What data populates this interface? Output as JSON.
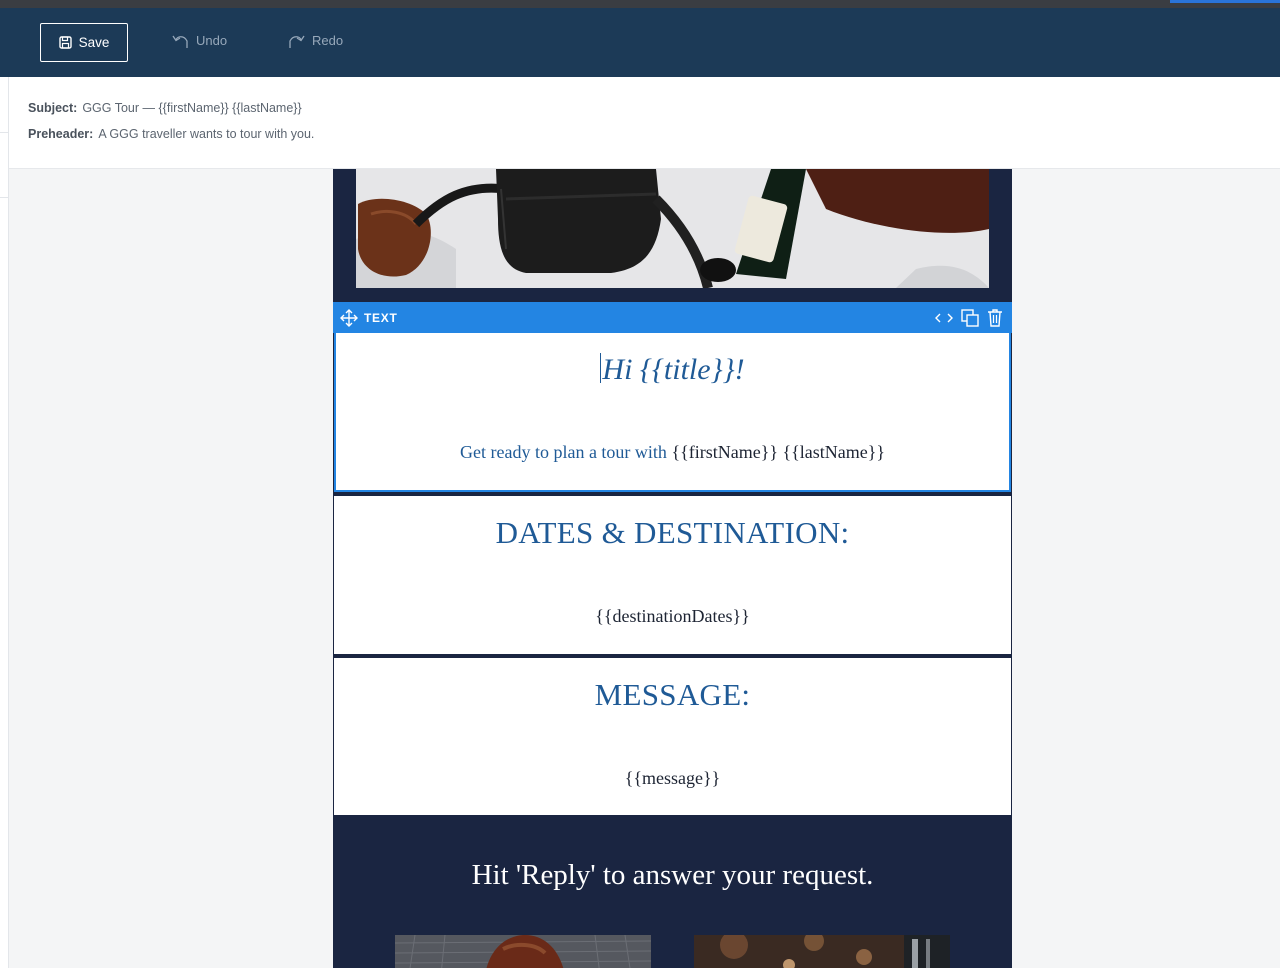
{
  "toolbar": {
    "save_label": "Save",
    "undo_label": "Undo",
    "redo_label": "Redo",
    "background": "#1c3a57"
  },
  "meta": {
    "subject_label": "Subject:",
    "subject_value": "GGG Tour — {{firstName}} {{lastName}}",
    "preheader_label": "Preheader:",
    "preheader_value": "A GGG traveller wants to tour with you."
  },
  "email": {
    "background": "#1a2541",
    "selected_block": {
      "type_label": "TEXT",
      "accent": "#2385e3",
      "actions": [
        "code-icon",
        "duplicate-icon",
        "trash-icon"
      ]
    },
    "greeting": "Hi {{title}}!",
    "intro_text": "Get ready to plan a tour with",
    "intro_names": "{{firstName}} {{lastName}}",
    "dates_title": "DATES & DESTINATION:",
    "dates_value": "{{destinationDates}}",
    "message_title": "MESSAGE:",
    "message_value": "{{message}}",
    "reply_text": "Hit 'Reply' to answer your request.",
    "heading_color": "#1f5a96"
  }
}
